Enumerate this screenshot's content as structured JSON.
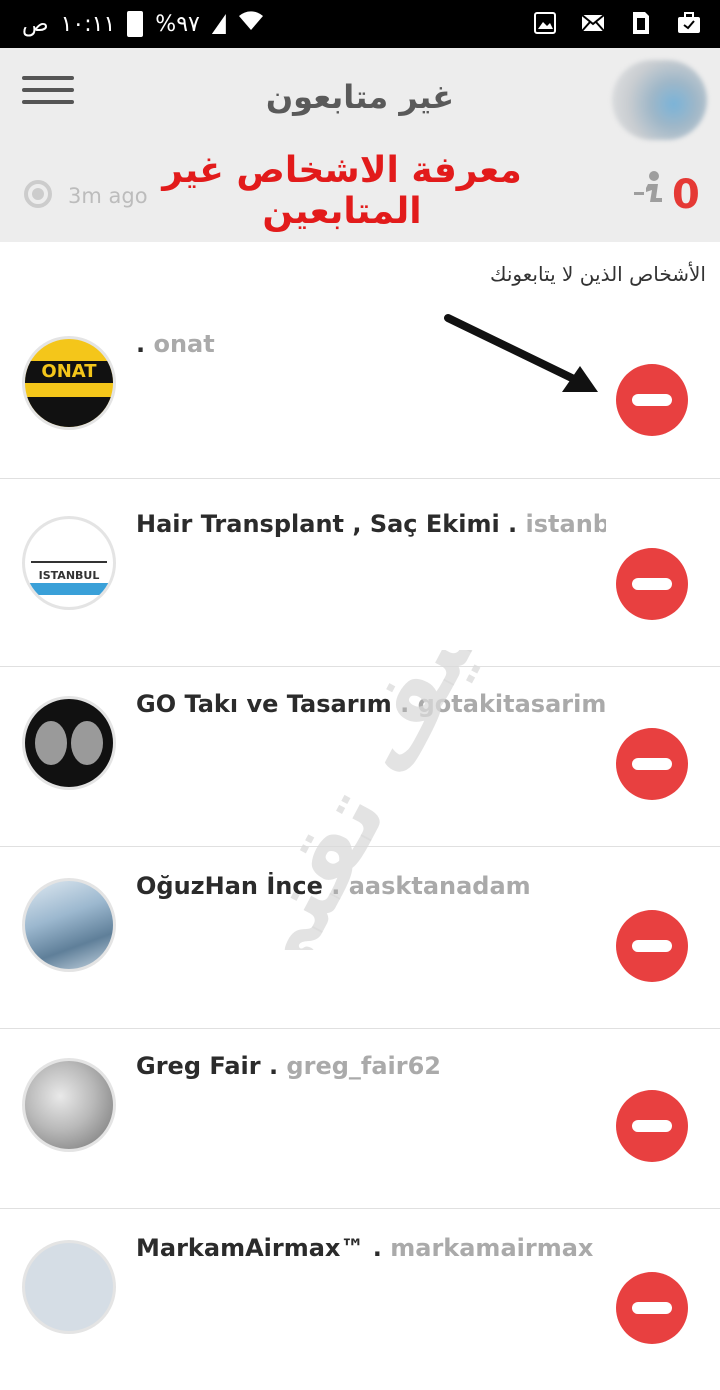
{
  "status_bar": {
    "time": "١٠:١١",
    "ampm": "ص",
    "battery": "%٩٧"
  },
  "header": {
    "title": "غير متابعون",
    "time_ago": "3m ago",
    "count": "0",
    "overlay_caption": "معرفة الاشخاص غير المتابعين"
  },
  "section_label": "الأشخاص الذين لا يتابعونك",
  "watermark_text": "كيف تقني",
  "users": [
    {
      "name": "",
      "username": "onat"
    },
    {
      "name": "Hair Transplant , Saç Ekimi",
      "username": "istanb..."
    },
    {
      "name": "GO Takı ve Tasarım",
      "username": "gotakitasarim"
    },
    {
      "name": "OğuzHan İnce",
      "username": "aasktanadam"
    },
    {
      "name": "Greg Fair",
      "username": "greg_fair62"
    },
    {
      "name": "MarkamAirmax™",
      "username": "markamairmax"
    }
  ],
  "colors": {
    "unfollow_button": "#e84040",
    "header_bg": "#ededed",
    "caption_red": "#e21b1b"
  }
}
